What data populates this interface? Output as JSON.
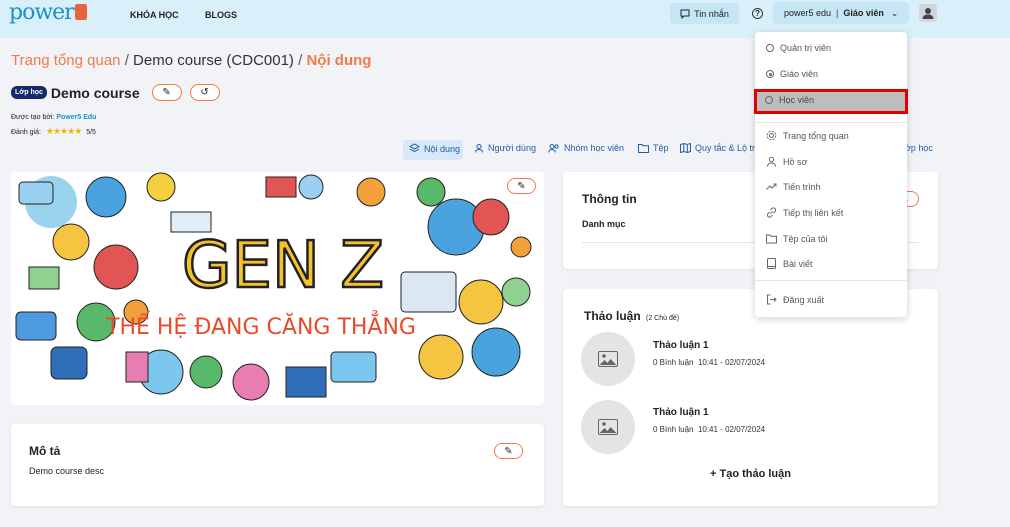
{
  "header": {
    "logo_text": "power",
    "nav": [
      "KHÓA HỌC",
      "BLOGS"
    ],
    "messages_label": "Tin nhắn",
    "help_symbol": "?",
    "user_name": "power5 edu",
    "user_sep": "|",
    "user_role": "Giáo viên",
    "chevron": "⌄"
  },
  "breadcrumb": {
    "home": "Trang tổng quan",
    "sep": "/",
    "course": "Demo course (CDC001)",
    "current": "Nội dung"
  },
  "course": {
    "badge": "Lớp học",
    "title": "Demo course",
    "edit_icon": "✎",
    "reset_icon": "↺",
    "created_by_label": "Được tạo bởi:",
    "created_by": "Power5 Edu",
    "rating_label": "Đánh giá:",
    "stars": "★★★★★",
    "rating": "5/5"
  },
  "tabs": {
    "items": [
      "Nội dung",
      "Người dùng",
      "Nhóm học viên",
      "Tệp",
      "Quy tắc & Lộ trì"
    ],
    "overflow": "ớp học"
  },
  "banner": {
    "line1": "GEN Z",
    "line2": "THẾ HỆ ĐANG CĂNG THẲNG"
  },
  "description": {
    "title": "Mô tả",
    "text": "Demo course desc"
  },
  "info": {
    "title": "Thông tin",
    "category": "Danh mục"
  },
  "discussions": {
    "title": "Thảo luận",
    "count": "(2 Chủ đề)",
    "items": [
      {
        "title": "Thảo luận 1",
        "comments": "0 Bình luận",
        "time": "10:41 - 02/07/2024"
      },
      {
        "title": "Thảo luận 1",
        "comments": "0 Bình luận",
        "time": "10:41 - 02/07/2024"
      }
    ],
    "create": "+ Tạo thảo luận"
  },
  "menu": {
    "roles": [
      "Quản trị viên",
      "Giáo viên",
      "Học viên"
    ],
    "selected_role": "Giáo viên",
    "items": [
      "Trang tổng quan",
      "Hồ sơ",
      "Tiến trình",
      "Tiếp thị liên kết",
      "Tệp của tôi",
      "Bài viết"
    ],
    "logout": "Đăng xuất"
  },
  "colors": {
    "accent": "#ef7b4a",
    "topbar": "#d9f0fb",
    "brand": "#1b8fc8",
    "highlight_border": "#e00000"
  }
}
